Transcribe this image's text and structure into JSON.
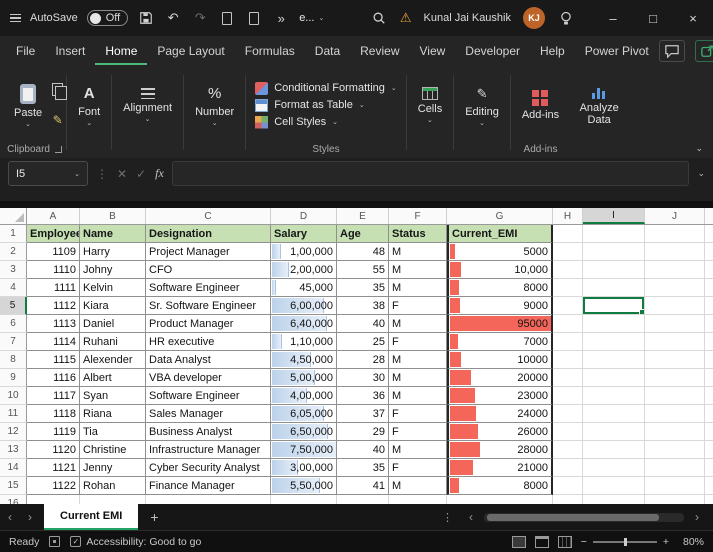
{
  "icons": {
    "chevron_down": "⌄",
    "undo": "↶",
    "redo": "↷",
    "overflow": "»",
    "warning": "⚠",
    "minimize": "–",
    "maximize": "□",
    "close": "×",
    "prev": "‹",
    "next": "›",
    "plus": "+",
    "dots": "⋮",
    "percent": "%",
    "font_letter": "A",
    "brush": "✎",
    "check": "✓",
    "zoom_minus": "−",
    "zoom_plus": "+",
    "cancel": "✕"
  },
  "titlebar": {
    "autosave_label": "AutoSave",
    "autosave_state": "Off",
    "doc_menu_label": "e...",
    "user_name": "Kunal Jai Kaushik",
    "user_initials": "KJ"
  },
  "menubar": {
    "items": [
      {
        "label": "File",
        "active": false
      },
      {
        "label": "Insert",
        "active": false
      },
      {
        "label": "Home",
        "active": true
      },
      {
        "label": "Page Layout",
        "active": false
      },
      {
        "label": "Formulas",
        "active": false
      },
      {
        "label": "Data",
        "active": false
      },
      {
        "label": "Review",
        "active": false
      },
      {
        "label": "View",
        "active": false
      },
      {
        "label": "Developer",
        "active": false
      },
      {
        "label": "Help",
        "active": false
      },
      {
        "label": "Power Pivot",
        "active": false
      }
    ]
  },
  "ribbon": {
    "paste_label": "Paste",
    "font_label": "Font",
    "alignment_label": "Alignment",
    "number_label": "Number",
    "conditional_formatting_label": "Conditional Formatting",
    "format_as_table_label": "Format as Table",
    "cell_styles_label": "Cell Styles",
    "cells_label": "Cells",
    "editing_label": "Editing",
    "add_ins_label": "Add-ins",
    "analyze_data_label": "Analyze Data",
    "group_labels": {
      "clipboard": "Clipboard",
      "styles": "Styles",
      "add_ins": "Add-ins"
    }
  },
  "formula_bar": {
    "name_box": "I5",
    "fx_label": "fx",
    "content": ""
  },
  "sheet": {
    "columns": [
      "A",
      "B",
      "C",
      "D",
      "E",
      "F",
      "G",
      "H",
      "I",
      "J"
    ],
    "selected_cell": "I5",
    "header_row": [
      "Employee",
      "Name",
      "Designation",
      "Salary",
      "Age",
      "Status",
      "Current_EMI"
    ],
    "rows": [
      {
        "employee": "1109",
        "name": "Harry",
        "designation": "Project Manager",
        "salary": "1,00,000",
        "age": "48",
        "status": "M",
        "emi": "5000"
      },
      {
        "employee": "1110",
        "name": "Johny",
        "designation": "CFO",
        "salary": "2,00,000",
        "age": "55",
        "status": "M",
        "emi": "10,000"
      },
      {
        "employee": "1111",
        "name": "Kelvin",
        "designation": "Software Engineer",
        "salary": "45,000",
        "age": "35",
        "status": "M",
        "emi": "8000"
      },
      {
        "employee": "1112",
        "name": "Kiara",
        "designation": "Sr. Software Engineer",
        "salary": "6,00,000",
        "age": "38",
        "status": "F",
        "emi": "9000"
      },
      {
        "employee": "1113",
        "name": "Daniel",
        "designation": "Product Manager",
        "salary": "6,40,000",
        "age": "40",
        "status": "M",
        "emi": "95000"
      },
      {
        "employee": "1114",
        "name": "Ruhani",
        "designation": "HR executive",
        "salary": "1,10,000",
        "age": "25",
        "status": "F",
        "emi": "7000"
      },
      {
        "employee": "1115",
        "name": "Alexender",
        "designation": "Data Analyst",
        "salary": "4,50,000",
        "age": "28",
        "status": "M",
        "emi": "10000"
      },
      {
        "employee": "1116",
        "name": "Albert",
        "designation": "VBA developer",
        "salary": "5,00,000",
        "age": "30",
        "status": "M",
        "emi": "20000"
      },
      {
        "employee": "1117",
        "name": "Syan",
        "designation": "Software Engineer",
        "salary": "4,00,000",
        "age": "36",
        "status": "M",
        "emi": "23000"
      },
      {
        "employee": "1118",
        "name": "Riana",
        "designation": "Sales Manager",
        "salary": "6,05,000",
        "age": "37",
        "status": "F",
        "emi": "24000"
      },
      {
        "employee": "1119",
        "name": "Tia",
        "designation": "Business Analyst",
        "salary": "6,50,000",
        "age": "29",
        "status": "F",
        "emi": "26000"
      },
      {
        "employee": "1120",
        "name": "Christine",
        "designation": "Infrastructure Manager",
        "salary": "7,50,000",
        "age": "40",
        "status": "M",
        "emi": "28000"
      },
      {
        "employee": "1121",
        "name": "Jenny",
        "designation": "Cyber Security Analyst",
        "salary": "3,00,000",
        "age": "35",
        "status": "F",
        "emi": "21000"
      },
      {
        "employee": "1122",
        "name": "Rohan",
        "designation": "Finance Manager",
        "salary": "5,50,000",
        "age": "41",
        "status": "M",
        "emi": "8000"
      }
    ]
  },
  "sheet_tabs": {
    "active": "Current EMI"
  },
  "statusbar": {
    "ready": "Ready",
    "accessibility": "Accessibility: Good to go",
    "zoom": "80%"
  }
}
